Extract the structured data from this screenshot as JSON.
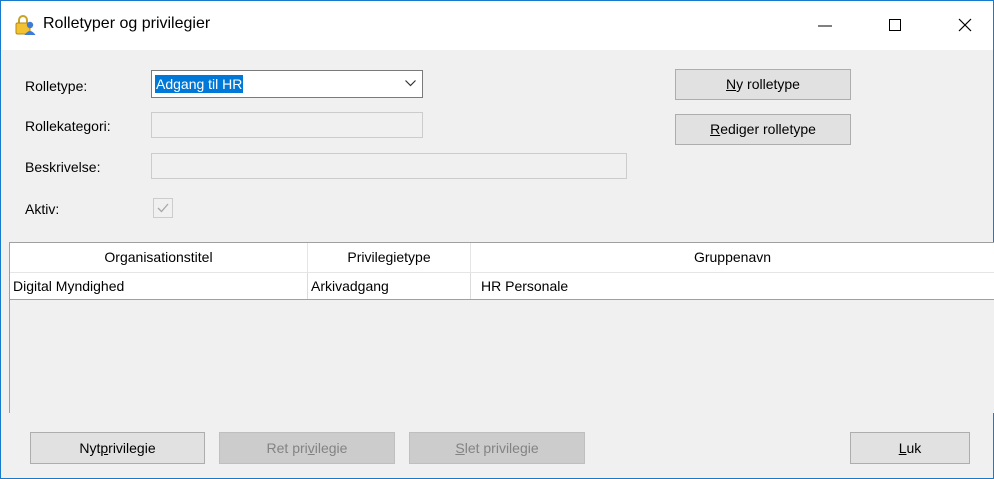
{
  "window": {
    "title": "Rolletyper og privilegier",
    "icon": "lock-user-icon",
    "controls": {
      "minimize": "minimize-icon",
      "maximize": "maximize-icon",
      "close": "close-icon"
    }
  },
  "form": {
    "rolletype_label": "Rolletype:",
    "rolletype_value": "Adgang til HR",
    "rollekategori_label": "Rollekategori:",
    "rollekategori_value": "",
    "beskrivelse_label": "Beskrivelse:",
    "beskrivelse_value": "",
    "aktiv_label": "Aktiv:",
    "aktiv_checked": true
  },
  "buttons": {
    "ny_rolletype": {
      "mnemonic": "N",
      "rest": "y rolletype"
    },
    "rediger_rolletype": {
      "mnemonic": "R",
      "rest": "ediger rolletype"
    },
    "nyt_privilegie": {
      "before": "Nyt ",
      "mnemonic": "p",
      "after": "rivilegie"
    },
    "ret_privilegie": {
      "before": "Ret pri",
      "mnemonic": "v",
      "after": "ilegie"
    },
    "slet_privilegie": {
      "mnemonic": "S",
      "rest": "let privilegie"
    },
    "luk": {
      "mnemonic": "L",
      "rest": "uk"
    }
  },
  "grid": {
    "columns": [
      "Organisationstitel",
      "Privilegietype",
      "Gruppenavn"
    ],
    "rows": [
      [
        "Digital Myndighed",
        "Arkivadgang",
        "HR Personale"
      ]
    ]
  },
  "colors": {
    "selection": "#0078d7",
    "window_border": "#1979ca",
    "background": "#f0f0f0"
  }
}
